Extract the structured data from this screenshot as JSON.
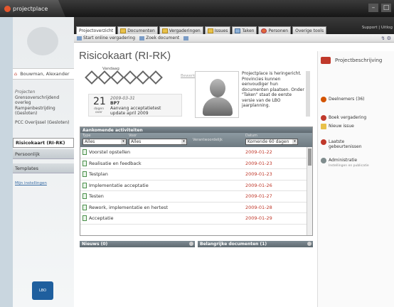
{
  "app": {
    "logo": "projectplace"
  },
  "sidebar": {
    "user": "Bouwman, Alexander",
    "projects_heading": "Projecten",
    "projects": [
      "Grensoverschrijdend overleg Rampenbestrijding (Gesloten)",
      "PCC Overijssel (Gesloten)"
    ],
    "selected": "Risicokaart (RI-RK)",
    "personal": "Persoonlijk",
    "templates": "Templates",
    "settings_link": "Mijn instellingen"
  },
  "tabs": [
    "Projectoverzicht",
    "Documenten",
    "Vergaderingen",
    "Issues",
    "Taken",
    "Personen",
    "Overige tools"
  ],
  "toplinks": "Support | Uitlog",
  "toolbar": {
    "start_meeting": "Start online vergadering",
    "find_doc": "Zoek document"
  },
  "page": {
    "title": "Risicokaart (RI-RK)"
  },
  "milestones": {
    "today_label": "Vandaag",
    "more_label": "Bewerken"
  },
  "milestone_card": {
    "day": "21",
    "day_sub": "dagen over",
    "date": "2009-03-31",
    "code": "BP7",
    "line1": "Aanvang acceptatietest",
    "line2": "update april 2009"
  },
  "info_text": "Projectplace is heringericht. Provincies kunnen eenvoudiger hun documenten plaatsen. Onder \"Taken\" staat de eerste versie van de LBO jaarplanning.",
  "activities": {
    "header": "Aankomende activiteiten",
    "filter_labels": {
      "type": "Type",
      "owner": "Voor",
      "responsible": "Verantwoordelijk",
      "date": "Datum"
    },
    "filter_values": {
      "type": "Alles",
      "owner": "Alles",
      "date": "Komende 60 dagen"
    },
    "rows": [
      {
        "name": "Voorstel opstellen",
        "date": "2009-01-22"
      },
      {
        "name": "Realisatie en feedback",
        "date": "2009-01-23"
      },
      {
        "name": "Testplan",
        "date": "2009-01-23"
      },
      {
        "name": "Implementatie acceptatie",
        "date": "2009-01-26"
      },
      {
        "name": "Testen",
        "date": "2009-01-27"
      },
      {
        "name": "Rework, implementatie en hertest",
        "date": "2009-01-28"
      },
      {
        "name": "Acceptatie",
        "date": "2009-01-29"
      }
    ]
  },
  "bottom_panels": {
    "news": "Nieuws (0)",
    "important_docs": "Belangrijke documenten (1)"
  },
  "right": {
    "title": "Projectbeschrijving",
    "members": "Deelnemers (36)",
    "book_meeting": "Boek vergadering",
    "new_issue": "Nieuw issue",
    "latest_events": "Laatste gebeurtenissen",
    "admin": "Administratie",
    "admin_sub": "Instellingen en publicatie"
  }
}
